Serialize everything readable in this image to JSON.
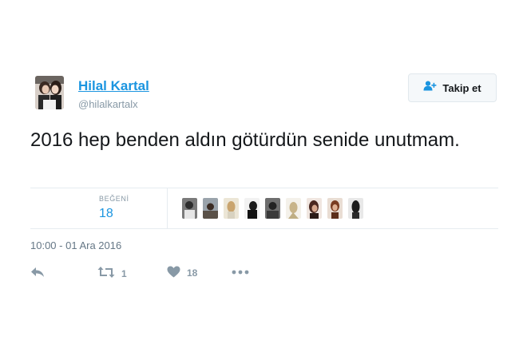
{
  "tweet": {
    "display_name": "Hilal Kartal",
    "handle": "@hilalkartalx",
    "follow_label": "Takip et",
    "text": "2016 hep benden aldın götürdün senide unutmam.",
    "likes_label": "BEĞENİ",
    "likes_count": "18",
    "timestamp": "10:00 - 01 Ara 2016",
    "actions": {
      "reply_icon": "reply-icon",
      "retweet_icon": "retweet-icon",
      "retweet_count": "1",
      "like_icon": "heart-icon",
      "like_count": "18",
      "more_icon": "more-icon"
    },
    "liker_avatar_count": 9
  },
  "colors": {
    "accent": "#1b95e0",
    "muted": "#8899a6",
    "text": "#14171a",
    "border": "#e6ecf0"
  }
}
